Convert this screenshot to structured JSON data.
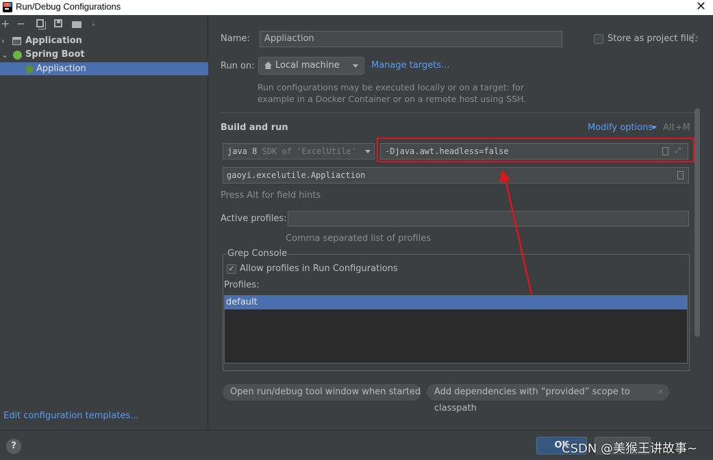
{
  "window": {
    "title": "Run/Debug Configurations",
    "close_glyph": "✕"
  },
  "sidebar": {
    "toolbar_glyphs": {
      "add": "+",
      "remove": "−",
      "sort": "⇣"
    },
    "tree": {
      "application": {
        "label": "Application",
        "arrow": "›"
      },
      "spring_boot": {
        "label": "Spring Boot",
        "arrow": "⌄"
      },
      "selected": {
        "label": "Appliaction"
      }
    },
    "edit_templates": "Edit configuration templates..."
  },
  "form": {
    "name_label": "Name:",
    "name_value": "Appliaction",
    "store_label": "Store as project file",
    "run_on_label": "Run on:",
    "run_on_value": "Local machine",
    "manage_targets": "Manage targets...",
    "run_hint_line1": "Run configurations may be executed locally or on a target: for",
    "run_hint_line2": "example in a Docker Container or on a remote host using SSH.",
    "build_title": "Build and run",
    "modify_options": "Modify options",
    "modify_shortcut": "Alt+M",
    "jdk_version": "java 8",
    "jdk_sdk": "SDK of 'ExcelUtile' m",
    "vm_options": "-Djava.awt.headless=false",
    "expand_glyph": "⤢",
    "main_class": "gaoyi.excelutile.Appliaction",
    "alt_hint": "Press Alt for field hints",
    "active_profiles_label": "Active profiles:",
    "active_profiles_value": "",
    "profiles_hint": "Comma separated list of profiles",
    "grep_title": "Grep Console",
    "allow_profiles_label": "Allow profiles in Run Configurations",
    "allow_profiles_checked": true,
    "check_glyph": "✓",
    "profiles_label": "Profiles:",
    "profiles_list": [
      "default"
    ],
    "chip_open_tool_window": "Open run/debug tool window when started",
    "chip_add_dependencies": "Add dependencies with “provided” scope to classpath",
    "chip_close": "✕"
  },
  "footer": {
    "help": "?",
    "ok_label": "OK",
    "watermark": "CSDN @美猴王讲故事~"
  },
  "colors": {
    "background": "#3c3f41",
    "selection": "#4b6eaf",
    "link": "#589df6",
    "highlight": "#e0141c"
  }
}
